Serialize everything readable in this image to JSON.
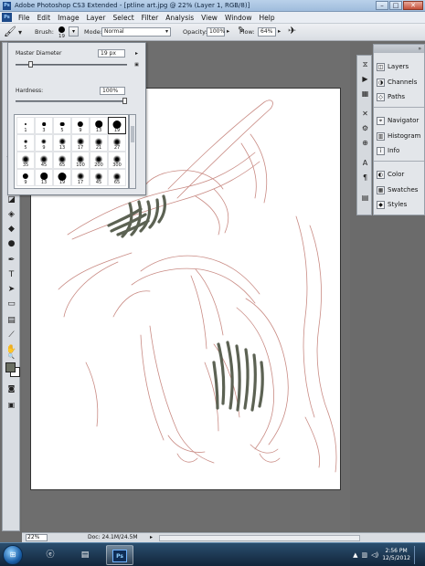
{
  "window": {
    "title": "Adobe Photoshop CS3 Extended - [ptline art.jpg @ 22% (Layer 1, RGB/8)]",
    "app_icon_label": "Ps",
    "min_glyph": "–",
    "max_glyph": "□",
    "close_glyph": "✕"
  },
  "menubar": {
    "logo": "Ps",
    "items": [
      "File",
      "Edit",
      "Image",
      "Layer",
      "Select",
      "Filter",
      "Analysis",
      "View",
      "Window",
      "Help"
    ]
  },
  "options": {
    "brush_label": "Brush:",
    "brush_size": "19",
    "mode_label": "Mode:",
    "mode_value": "Normal",
    "opacity_label": "Opacity:",
    "opacity_value": "100%",
    "flow_label": "Flow:",
    "flow_value": "64%"
  },
  "brush_picker": {
    "master_diameter_label": "Master Diameter",
    "master_diameter_value": "19 px",
    "hardness_label": "Hardness:",
    "hardness_value": "100%",
    "master_diameter_fraction": 0.12,
    "hardness_fraction": 1.0,
    "presets": [
      {
        "size": "1",
        "kind": "hard"
      },
      {
        "size": "3",
        "kind": "hard"
      },
      {
        "size": "5",
        "kind": "hard"
      },
      {
        "size": "9",
        "kind": "hard"
      },
      {
        "size": "13",
        "kind": "hard"
      },
      {
        "size": "19",
        "kind": "hard",
        "selected": true
      },
      {
        "size": "5",
        "kind": "soft"
      },
      {
        "size": "9",
        "kind": "soft"
      },
      {
        "size": "13",
        "kind": "soft"
      },
      {
        "size": "17",
        "kind": "soft"
      },
      {
        "size": "21",
        "kind": "soft"
      },
      {
        "size": "27",
        "kind": "soft"
      },
      {
        "size": "35",
        "kind": "soft"
      },
      {
        "size": "45",
        "kind": "soft"
      },
      {
        "size": "65",
        "kind": "soft"
      },
      {
        "size": "100",
        "kind": "soft"
      },
      {
        "size": "200",
        "kind": "soft"
      },
      {
        "size": "300",
        "kind": "soft"
      },
      {
        "size": "9",
        "kind": "hard"
      },
      {
        "size": "13",
        "kind": "hard"
      },
      {
        "size": "19",
        "kind": "hard"
      },
      {
        "size": "17",
        "kind": "soft"
      },
      {
        "size": "45",
        "kind": "soft"
      },
      {
        "size": "65",
        "kind": "soft"
      }
    ]
  },
  "panels": {
    "group1": [
      "Layers",
      "Channels",
      "Paths"
    ],
    "group2": [
      "Navigator",
      "Histogram",
      "Info"
    ],
    "group3": [
      "Color",
      "Swatches",
      "Styles"
    ]
  },
  "status": {
    "zoom": "22%",
    "doc": "Doc: 24.1M/24.5M"
  },
  "taskbar": {
    "time": "2:56 PM",
    "date": "12/5/2012"
  },
  "colors": {
    "foreground": "#6a6f62",
    "background": "#ffffff",
    "sketch_line": "#c98b84",
    "fill_stroke": "#5c6253"
  }
}
